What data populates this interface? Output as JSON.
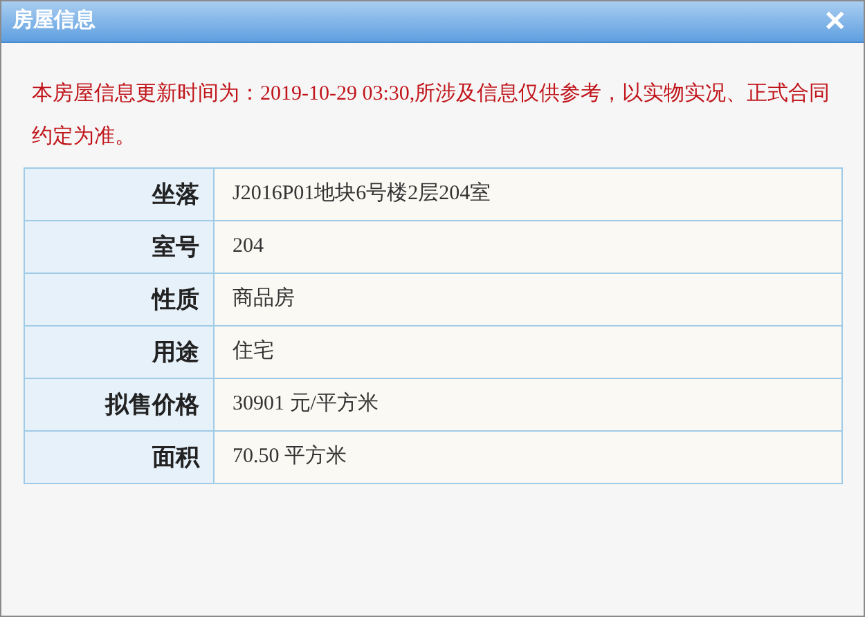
{
  "window": {
    "title": "房屋信息",
    "close": "✕"
  },
  "notice": "本房屋信息更新时间为：2019-10-29 03:30,所涉及信息仅供参考，以实物实况、正式合同约定为准。",
  "rows": [
    {
      "label": "坐落",
      "value": "J2016P01地块6号楼2层204室"
    },
    {
      "label": "室号",
      "value": "204"
    },
    {
      "label": "性质",
      "value": "商品房"
    },
    {
      "label": "用途",
      "value": "住宅"
    },
    {
      "label": "拟售价格",
      "value": "30901 元/平方米"
    },
    {
      "label": "面积",
      "value": "70.50 平方米"
    }
  ]
}
